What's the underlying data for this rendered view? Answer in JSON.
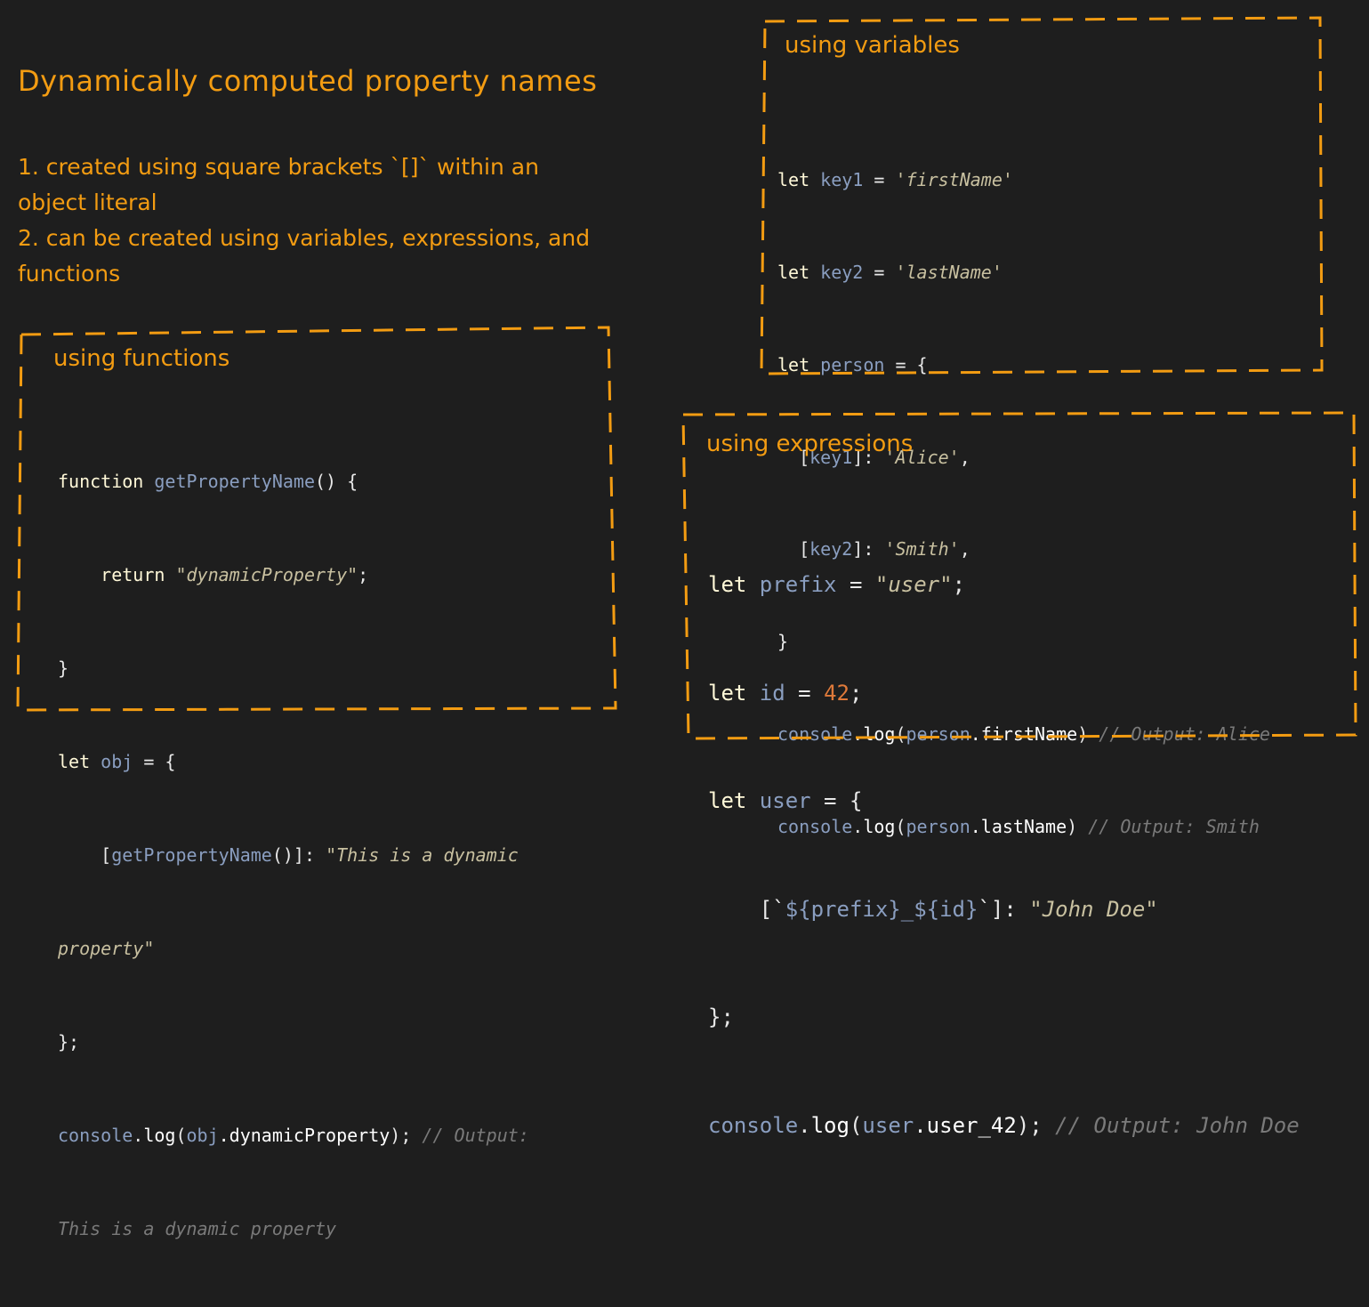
{
  "header": {
    "title": "Dynamically computed property names",
    "points": [
      "1. created using square brackets `[]` within an",
      "object literal",
      "2. can be created using variables, expressions, and",
      "functions"
    ]
  },
  "variables_box": {
    "title": "using variables",
    "code": {
      "l1_kw": "let",
      "l1_var": "key1",
      "l1_op": " = ",
      "l1_str": "'firstName'",
      "l2_kw": "let",
      "l2_var": "key2",
      "l2_op": " = ",
      "l2_str": "'lastName'",
      "l3_kw": "let",
      "l3_var": "person",
      "l3_op": " = {",
      "l4_open": "  [",
      "l4_var": "key1",
      "l4_close": "]: ",
      "l4_str": "'Alice'",
      "l4_end": ",",
      "l5_open": "  [",
      "l5_var": "key2",
      "l5_close": "]: ",
      "l5_str": "'Smith'",
      "l5_end": ",",
      "l6": "}",
      "l7_obj": "console",
      "l7_dot": ".",
      "l7_fn": "log",
      "l7_p": "(",
      "l7_var": "person",
      "l7_prop": ".firstName",
      "l7_pc": ") ",
      "l7_cmt": "// Output: Alice",
      "l8_obj": "console",
      "l8_dot": ".",
      "l8_fn": "log",
      "l8_p": "(",
      "l8_var": "person",
      "l8_prop": ".lastName",
      "l8_pc": ") ",
      "l8_cmt": "// Output: Smith"
    }
  },
  "functions_box": {
    "title": "using functions",
    "code": {
      "l1_kw": "function",
      "l1_name": " getPropertyName",
      "l1_rest": "() {",
      "l2_indent": "    ",
      "l2_kw": "return",
      "l2_str": " \"dynamicProperty\"",
      "l2_end": ";",
      "l3": "}",
      "l4_kw": "let",
      "l4_var": " obj",
      "l4_rest": " = {",
      "l5_indent": "    [",
      "l5_name": "getPropertyName",
      "l5_rest": "()]: ",
      "l5_str": "\"This is a dynamic",
      "l6_str": "property\"",
      "l7": "};",
      "l8_obj": "console",
      "l8_dot": ".",
      "l8_fn": "log",
      "l8_p": "(",
      "l8_var": "obj",
      "l8_prop": ".dynamicProperty",
      "l8_pc": "); ",
      "l8_cmt": "// Output:",
      "l9_cmt": "This is a dynamic property"
    }
  },
  "expressions_box": {
    "title": "using expressions",
    "code": {
      "l1_kw": "let",
      "l1_var": " prefix",
      "l1_op": " = ",
      "l1_str": "\"user\"",
      "l1_end": ";",
      "l2_kw": "let",
      "l2_var": " id",
      "l2_op": " = ",
      "l2_num": "42",
      "l2_end": ";",
      "l3_kw": "let",
      "l3_var": " user",
      "l3_op": " = {",
      "l4_indent": "    [`",
      "l4_tpl": "${prefix}_${id}",
      "l4_close": "`]: ",
      "l4_str": "\"John Doe\"",
      "l5": "};",
      "l6_obj": "console",
      "l6_dot": ".",
      "l6_fn": "log",
      "l6_p": "(",
      "l6_var": "user",
      "l6_prop": ".user_42",
      "l6_pc": "); ",
      "l6_cmt": "// Output: John Doe"
    }
  },
  "colors": {
    "accent": "#f39c12",
    "background": "#1e1e1e"
  }
}
